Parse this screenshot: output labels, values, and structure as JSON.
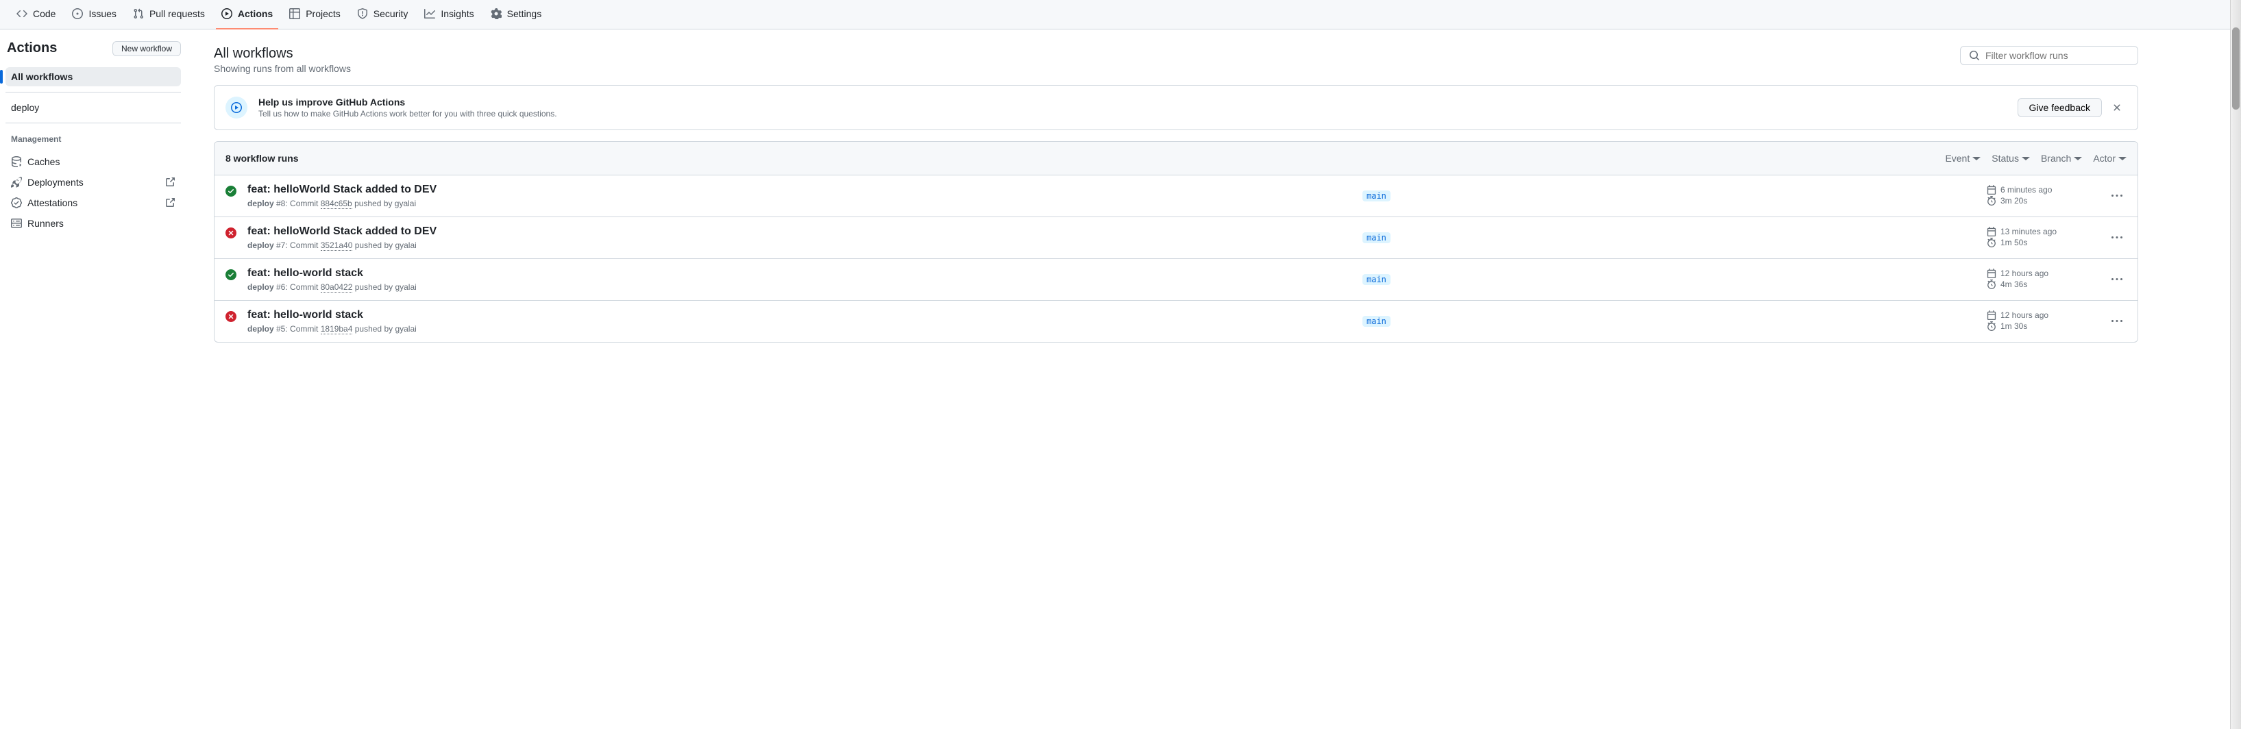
{
  "repo_nav": {
    "items": [
      {
        "label": "Code"
      },
      {
        "label": "Issues"
      },
      {
        "label": "Pull requests"
      },
      {
        "label": "Actions"
      },
      {
        "label": "Projects"
      },
      {
        "label": "Security"
      },
      {
        "label": "Insights"
      },
      {
        "label": "Settings"
      }
    ]
  },
  "sidebar": {
    "title": "Actions",
    "new_workflow_label": "New workflow",
    "items": [
      {
        "label": "All workflows"
      },
      {
        "label": "deploy"
      }
    ],
    "management_label": "Management",
    "management_items": [
      {
        "label": "Caches"
      },
      {
        "label": "Deployments"
      },
      {
        "label": "Attestations"
      },
      {
        "label": "Runners"
      }
    ]
  },
  "content": {
    "title": "All workflows",
    "subtitle": "Showing runs from all workflows"
  },
  "search": {
    "placeholder": "Filter workflow runs"
  },
  "feedback": {
    "title": "Help us improve GitHub Actions",
    "text": "Tell us how to make GitHub Actions work better for you with three quick questions.",
    "button": "Give feedback"
  },
  "runs_header": {
    "count_label": "8 workflow runs",
    "filters": [
      "Event",
      "Status",
      "Branch",
      "Actor"
    ]
  },
  "runs": [
    {
      "status": "success",
      "title": "feat: helloWorld Stack added to DEV",
      "workflow": "deploy",
      "run_number": "#8",
      "commit_label": "Commit",
      "sha": "884c65b",
      "pushed_by_label": "pushed by",
      "actor": "gyalai",
      "branch": "main",
      "time_ago": "6 minutes ago",
      "duration": "3m 20s"
    },
    {
      "status": "failure",
      "title": "feat: helloWorld Stack added to DEV",
      "workflow": "deploy",
      "run_number": "#7",
      "commit_label": "Commit",
      "sha": "3521a40",
      "pushed_by_label": "pushed by",
      "actor": "gyalai",
      "branch": "main",
      "time_ago": "13 minutes ago",
      "duration": "1m 50s"
    },
    {
      "status": "success",
      "title": "feat: hello-world stack",
      "workflow": "deploy",
      "run_number": "#6",
      "commit_label": "Commit",
      "sha": "80a0422",
      "pushed_by_label": "pushed by",
      "actor": "gyalai",
      "branch": "main",
      "time_ago": "12 hours ago",
      "duration": "4m 36s"
    },
    {
      "status": "failure",
      "title": "feat: hello-world stack",
      "workflow": "deploy",
      "run_number": "#5",
      "commit_label": "Commit",
      "sha": "1819ba4",
      "pushed_by_label": "pushed by",
      "actor": "gyalai",
      "branch": "main",
      "time_ago": "12 hours ago",
      "duration": "1m 30s"
    }
  ]
}
